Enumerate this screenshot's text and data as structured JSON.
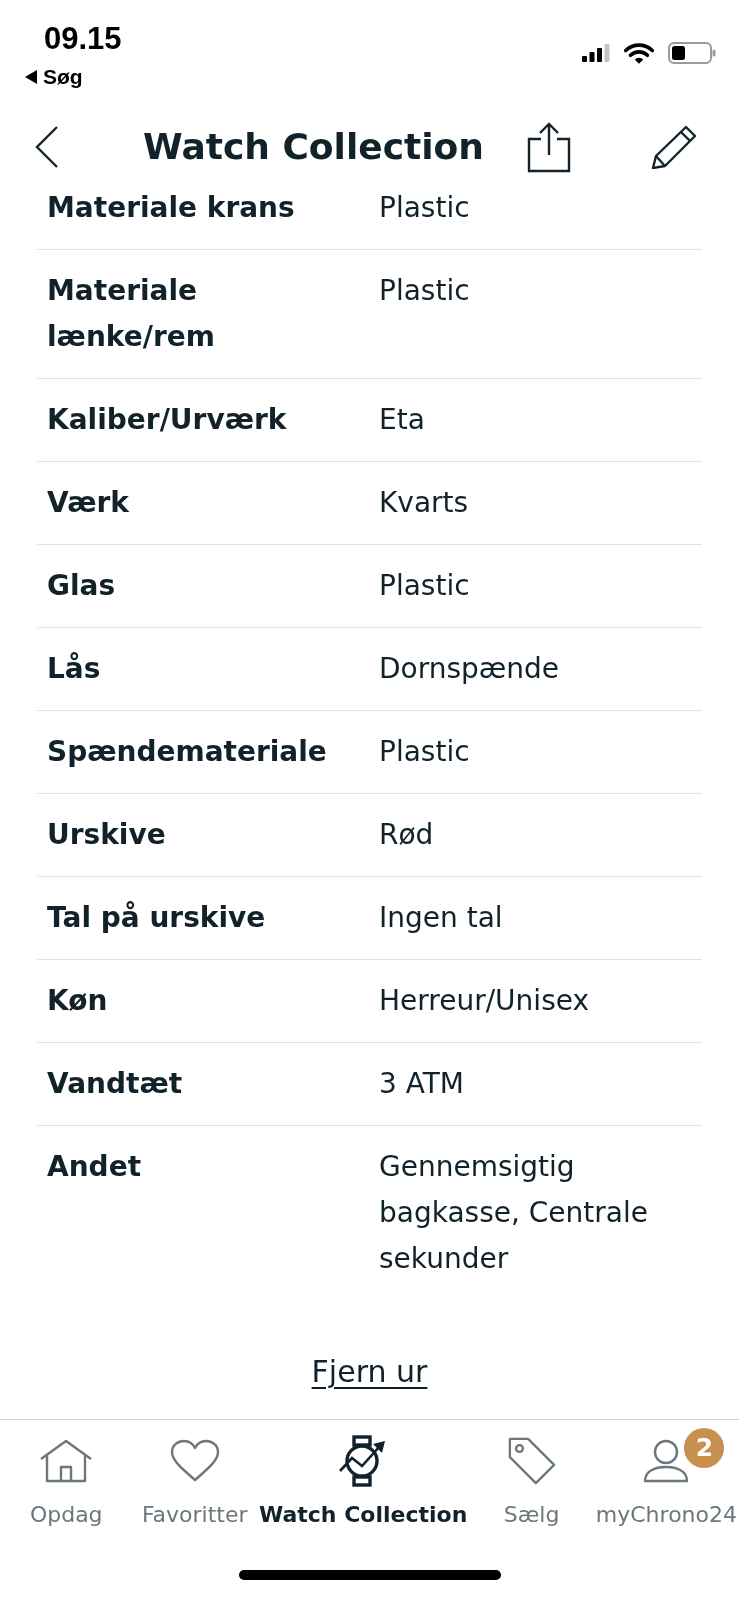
{
  "status_bar": {
    "time": "09.15",
    "back_label": "Søg"
  },
  "header": {
    "title": "Watch Collection"
  },
  "specs": [
    {
      "label": "Materiale krans",
      "value": "Plastic"
    },
    {
      "label": "Materiale lænke/rem",
      "value": "Plastic"
    },
    {
      "label": "Kaliber/Urværk",
      "value": "Eta"
    },
    {
      "label": "Værk",
      "value": "Kvarts"
    },
    {
      "label": "Glas",
      "value": "Plastic"
    },
    {
      "label": "Lås",
      "value": "Dornspænde"
    },
    {
      "label": "Spændemateriale",
      "value": "Plastic"
    },
    {
      "label": "Urskive",
      "value": "Rød"
    },
    {
      "label": "Tal på urskive",
      "value": "Ingen tal"
    },
    {
      "label": "Køn",
      "value": "Herreur/Unisex"
    },
    {
      "label": "Vandtæt",
      "value": "3 ATM"
    },
    {
      "label": "Andet",
      "value": "Gennemsigtig bagkasse, Centrale sekunder"
    }
  ],
  "remove_link": "Fjern ur",
  "tab_bar": {
    "items": [
      {
        "label": "Opdag",
        "selected": false
      },
      {
        "label": "Favoritter",
        "selected": false
      },
      {
        "label": "Watch Collection",
        "selected": true
      },
      {
        "label": "Sælg",
        "selected": false
      },
      {
        "label": "myChrono24",
        "selected": false,
        "badge": "2"
      }
    ]
  }
}
